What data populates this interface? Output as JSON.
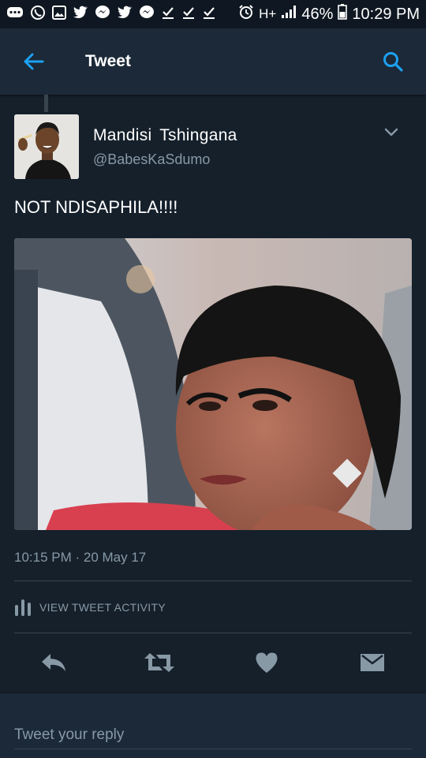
{
  "status_bar": {
    "icons": [
      "chat-icon",
      "whatsapp-icon",
      "gallery-icon",
      "twitter-icon",
      "messenger-icon",
      "twitter-icon",
      "messenger-icon",
      "download-done-icon",
      "download-done-icon",
      "download-done-icon",
      "alarm-icon",
      "data-icon",
      "signal-icon"
    ],
    "data_label": "H+",
    "battery": "46%",
    "time": "10:29 PM"
  },
  "app_bar": {
    "title": "Tweet"
  },
  "tweet": {
    "author_name": "Mandisi  Tshingana",
    "handle": "@BabesKaSdumo",
    "text": "NOT NDISAPHILA!!!!",
    "photo_alt": "Photo",
    "timestamp": "10:15 PM · 20 May 17",
    "activity_label": "VIEW TWEET ACTIVITY"
  },
  "actions": [
    "reply-icon",
    "retweet-icon",
    "like-icon",
    "direct-message-icon"
  ],
  "reply": {
    "placeholder": "Tweet your reply"
  },
  "colors": {
    "background": "#15202b",
    "app_bar": "#1c2938",
    "accent": "#1da1f2",
    "secondary_text": "#8899a6",
    "divider": "#38444d"
  }
}
